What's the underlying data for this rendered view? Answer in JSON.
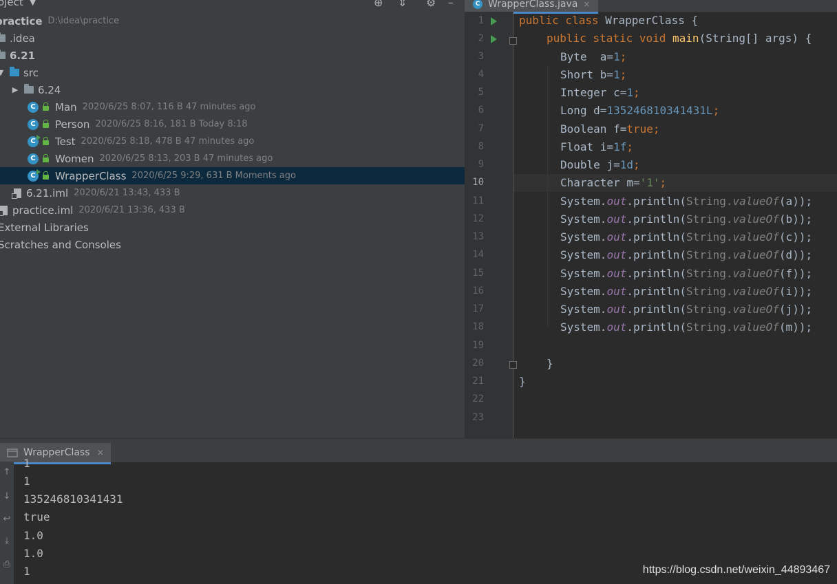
{
  "project": {
    "title": "oject",
    "tree": [
      {
        "name": "practice",
        "meta": "D:\\idea\\practice"
      },
      {
        "name": ".idea",
        "meta": ""
      },
      {
        "name": "6.21",
        "meta": ""
      },
      {
        "name": "src",
        "meta": ""
      },
      {
        "name": "6.24",
        "meta": ""
      },
      {
        "name": "Man",
        "meta": "2020/6/25 8:07, 116 B 47 minutes ago"
      },
      {
        "name": "Person",
        "meta": "2020/6/25 8:16, 181 B Today 8:18"
      },
      {
        "name": "Test",
        "meta": "2020/6/25 8:18, 478 B 47 minutes ago"
      },
      {
        "name": "Women",
        "meta": "2020/6/25 8:13, 203 B 47 minutes ago"
      },
      {
        "name": "WrapperClass",
        "meta": "2020/6/25 9:29, 631 B Moments ago"
      },
      {
        "name": "6.21.iml",
        "meta": "2020/6/21 13:43, 433 B"
      },
      {
        "name": "practice.iml",
        "meta": "2020/6/21 13:36, 433 B"
      },
      {
        "name": "External Libraries",
        "meta": ""
      },
      {
        "name": "Scratches and Consoles",
        "meta": ""
      }
    ]
  },
  "editor": {
    "tab": "WrapperClass.java",
    "tab_close": "×",
    "line_numbers": [
      "1",
      "2",
      "3",
      "4",
      "5",
      "6",
      "7",
      "8",
      "9",
      "10",
      "11",
      "12",
      "13",
      "14",
      "15",
      "16",
      "17",
      "18",
      "19",
      "20",
      "21",
      "22",
      "23"
    ],
    "current_line": "10",
    "code": {
      "l1_kw": "public class ",
      "l1_name": "WrapperClass {",
      "l2_kw": "public static void ",
      "l2_fn": "main",
      "l2_rest": "(String[] args) {",
      "l3_decl": "Byte  a=",
      "l3_val": "1",
      "l4_decl": "Short b=",
      "l4_val": "1",
      "l5_decl": "Integer c=",
      "l5_val": "1",
      "l6_decl": "Long d=",
      "l6_val": "135246810341431L",
      "l7_decl": "Boolean f=",
      "l7_val": "true",
      "l8_decl": "Float i=",
      "l8_val": "1f",
      "l9_decl": "Double j=",
      "l9_val": "1d",
      "l10_decl": "Character m=",
      "l10_val": "'1'",
      "semi": ";",
      "print_lines": [
        {
          "pre": "System.",
          "out": "out",
          "mid": ".println(",
          "cls": "String.",
          "method": "valueOf",
          "arg": "(a)",
          "post": ");"
        },
        {
          "pre": "System.",
          "out": "out",
          "mid": ".println(",
          "cls": "String.",
          "method": "valueOf",
          "arg": "(b)",
          "post": ");"
        },
        {
          "pre": "System.",
          "out": "out",
          "mid": ".println(",
          "cls": "String.",
          "method": "valueOf",
          "arg": "(c)",
          "post": ");"
        },
        {
          "pre": "System.",
          "out": "out",
          "mid": ".println(",
          "cls": "String.",
          "method": "valueOf",
          "arg": "(d)",
          "post": ");"
        },
        {
          "pre": "System.",
          "out": "out",
          "mid": ".println(",
          "cls": "String.",
          "method": "valueOf",
          "arg": "(f)",
          "post": ");"
        },
        {
          "pre": "System.",
          "out": "out",
          "mid": ".println(",
          "cls": "String.",
          "method": "valueOf",
          "arg": "(i)",
          "post": ");"
        },
        {
          "pre": "System.",
          "out": "out",
          "mid": ".println(",
          "cls": "String.",
          "method": "valueOf",
          "arg": "(j)",
          "post": ");"
        },
        {
          "pre": "System.",
          "out": "out",
          "mid": ".println(",
          "cls": "String.",
          "method": "valueOf",
          "arg": "(m)",
          "post": ");"
        }
      ],
      "close_method": "}",
      "close_class": "}"
    }
  },
  "run": {
    "tab": "WrapperClass",
    "tab_close": "×",
    "output": [
      "1",
      "1",
      "135246810341431",
      "true",
      "1.0",
      "1.0",
      "1"
    ]
  },
  "watermark": "https://blog.csdn.net/weixin_44893467",
  "colors": {
    "accent": "#4a88c7",
    "selection": "#0d293e",
    "keyword": "#cc7832",
    "number": "#6897bb",
    "run_green": "#499c54"
  }
}
